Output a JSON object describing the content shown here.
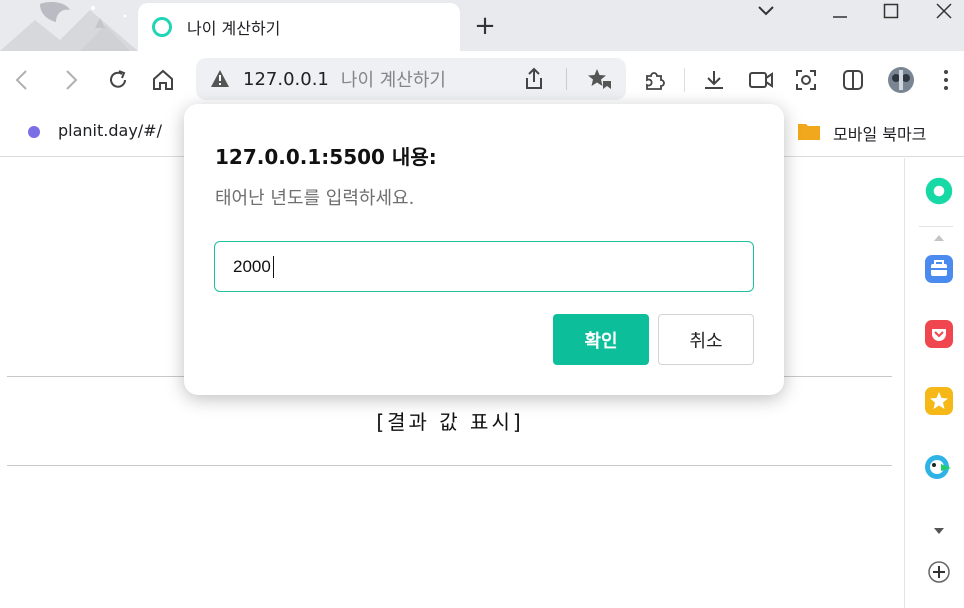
{
  "tab": {
    "title": "나이 계산하기",
    "new_tab": "+"
  },
  "window": {
    "minimize": "—",
    "maximize": "☐",
    "close": "✕"
  },
  "address_bar": {
    "host": "127.0.0.1",
    "page_title": "나이 계산하기"
  },
  "bookmarks": {
    "item": "planit.day/#/",
    "folder": "모바일 북마크"
  },
  "page": {
    "result_text": "[결과 값 표시]"
  },
  "dialog": {
    "title": "127.0.0.1:5500 내용:",
    "message": "태어난 년도를 입력하세요.",
    "input_value": "2000",
    "ok_label": "확인",
    "cancel_label": "취소"
  },
  "colors": {
    "accent": "#0cbf9a",
    "favicon": "#1fd5b6",
    "bookmark_dot": "#7b6ee6"
  },
  "icons": {
    "toolbar": [
      "back-icon",
      "forward-icon",
      "reload-icon",
      "home-icon",
      "warning-icon",
      "share-icon",
      "favorites-icon",
      "extensions-icon",
      "download-icon",
      "video-icon",
      "screenshot-icon",
      "split-view-icon",
      "profile-icon",
      "more-icon"
    ],
    "side_panel": [
      "whale-icon",
      "toolbox-icon",
      "pocket-icon",
      "bookmark-star-icon",
      "papago-icon",
      "scroll-up-icon",
      "scroll-down-icon",
      "add-icon"
    ]
  }
}
